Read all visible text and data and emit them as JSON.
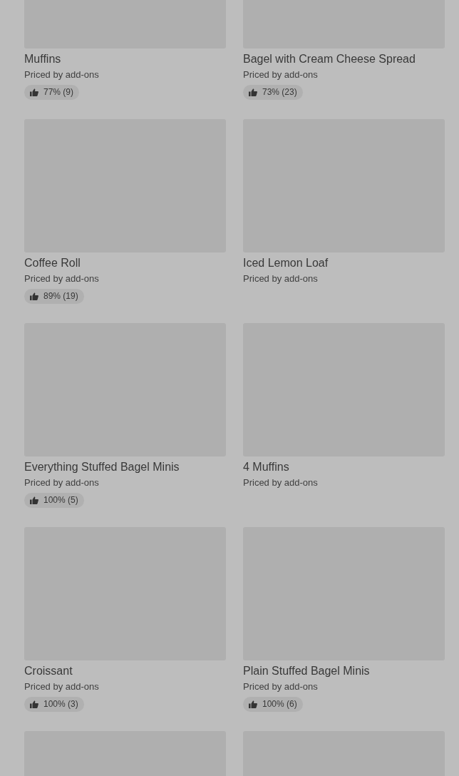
{
  "items": [
    {
      "kind": "product",
      "title": "Muffins",
      "subtitle": "Priced by add-ons",
      "rating": "77% (9)"
    },
    {
      "kind": "product",
      "title": "Bagel with Cream Cheese Spread",
      "subtitle": "Priced by add-ons",
      "rating": "73% (23)"
    },
    {
      "kind": "product",
      "title": "Coffee Roll",
      "subtitle": "Priced by add-ons",
      "rating": "89% (19)"
    },
    {
      "kind": "product",
      "title": "Iced Lemon Loaf",
      "subtitle": "Priced by add-ons"
    },
    {
      "kind": "product",
      "title": "Everything Stuffed Bagel Minis",
      "subtitle": "Priced by add-ons",
      "rating": "100% (5)"
    },
    {
      "kind": "product",
      "title": "4 Muffins",
      "subtitle": "Priced by add-ons"
    },
    {
      "kind": "product",
      "title": "Croissant",
      "subtitle": "Priced by add-ons",
      "rating": "100% (3)"
    },
    {
      "kind": "product",
      "title": "Plain Stuffed Bagel Minis",
      "subtitle": "Priced by add-ons",
      "rating": "100% (6)"
    },
    {
      "kind": "picture"
    },
    {
      "kind": "picture"
    }
  ]
}
